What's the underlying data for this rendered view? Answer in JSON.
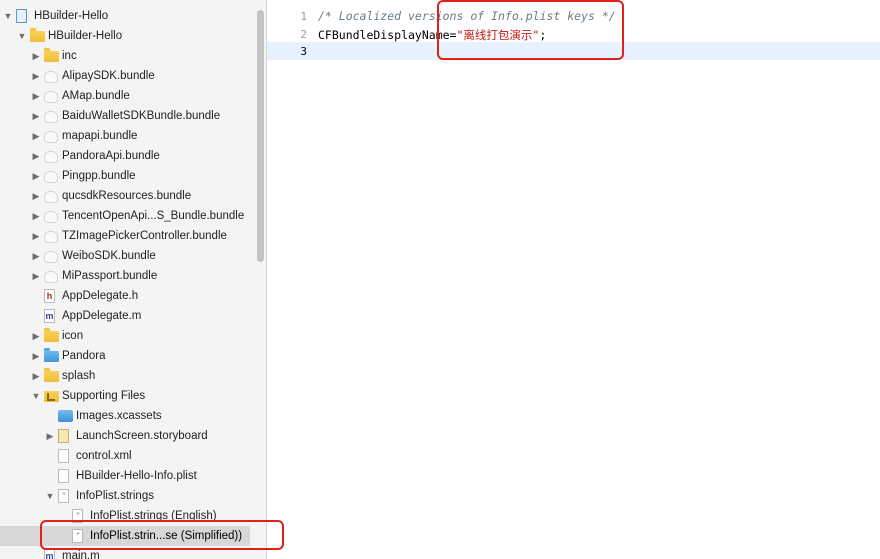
{
  "navigator": {
    "items": [
      {
        "label": "HBuilder-Hello",
        "icon": "project-icon",
        "disclosure": "down"
      },
      {
        "label": "HBuilder-Hello",
        "icon": "folder-icon",
        "disclosure": "down"
      },
      {
        "label": "inc",
        "icon": "folder-icon",
        "disclosure": "right"
      },
      {
        "label": "AlipaySDK.bundle",
        "icon": "bundle-icon",
        "disclosure": "right"
      },
      {
        "label": "AMap.bundle",
        "icon": "bundle-icon",
        "disclosure": "right"
      },
      {
        "label": "BaiduWalletSDKBundle.bundle",
        "icon": "bundle-icon",
        "disclosure": "right"
      },
      {
        "label": "mapapi.bundle",
        "icon": "bundle-icon",
        "disclosure": "right"
      },
      {
        "label": "PandoraApi.bundle",
        "icon": "bundle-icon",
        "disclosure": "right"
      },
      {
        "label": "Pingpp.bundle",
        "icon": "bundle-icon",
        "disclosure": "right"
      },
      {
        "label": "qucsdkResources.bundle",
        "icon": "bundle-icon",
        "disclosure": "right"
      },
      {
        "label": "TencentOpenApi...S_Bundle.bundle",
        "icon": "bundle-icon",
        "disclosure": "right"
      },
      {
        "label": "TZImagePickerController.bundle",
        "icon": "bundle-icon",
        "disclosure": "right"
      },
      {
        "label": "WeiboSDK.bundle",
        "icon": "bundle-icon",
        "disclosure": "right"
      },
      {
        "label": "MiPassport.bundle",
        "icon": "bundle-icon",
        "disclosure": "right"
      },
      {
        "label": "AppDelegate.h",
        "icon": "header-file-icon",
        "glyph": "h",
        "disclosure": ""
      },
      {
        "label": "AppDelegate.m",
        "icon": "source-file-icon",
        "glyph": "m",
        "disclosure": ""
      },
      {
        "label": "icon",
        "icon": "folder-icon",
        "disclosure": "right"
      },
      {
        "label": "Pandora",
        "icon": "blue-folder-icon",
        "disclosure": "right"
      },
      {
        "label": "splash",
        "icon": "folder-icon",
        "disclosure": "right"
      },
      {
        "label": "Supporting Files",
        "icon": "supporting-folder-icon",
        "disclosure": "down"
      },
      {
        "label": "Images.xcassets",
        "icon": "asset-catalog-icon",
        "disclosure": ""
      },
      {
        "label": "LaunchScreen.storyboard",
        "icon": "storyboard-icon",
        "disclosure": "right"
      },
      {
        "label": "control.xml",
        "icon": "xml-file-icon",
        "disclosure": ""
      },
      {
        "label": "HBuilder-Hello-Info.plist",
        "icon": "plist-file-icon",
        "disclosure": ""
      },
      {
        "label": "InfoPlist.strings",
        "icon": "strings-file-icon",
        "glyph": "\"",
        "disclosure": "down"
      },
      {
        "label": "InfoPlist.strings (English)",
        "icon": "strings-file-icon",
        "glyph": "\"",
        "disclosure": ""
      },
      {
        "label": "InfoPlist.strin...se (Simplified))",
        "icon": "strings-file-icon",
        "glyph": "\"",
        "disclosure": "",
        "selected": true
      },
      {
        "label": "main.m",
        "icon": "source-file-icon",
        "glyph": "m",
        "disclosure": ""
      }
    ],
    "disclosure_glyphs": {
      "down": "▼",
      "right": "▶"
    }
  },
  "editor": {
    "lines": [
      {
        "number": "1",
        "comment": "/* Localized versions of Info.plist keys */"
      },
      {
        "number": "2",
        "key": "CFBundleDisplayName=",
        "value": "\"离线打包演示\"",
        "terminator": ";"
      },
      {
        "number": "3"
      }
    ]
  },
  "colors": {
    "annotation_red": "#e0201b",
    "selection": "#d7d7d7",
    "current_line": "#e8f2ff",
    "string_literal": "#c41a16",
    "comment": "#6b7a86"
  }
}
